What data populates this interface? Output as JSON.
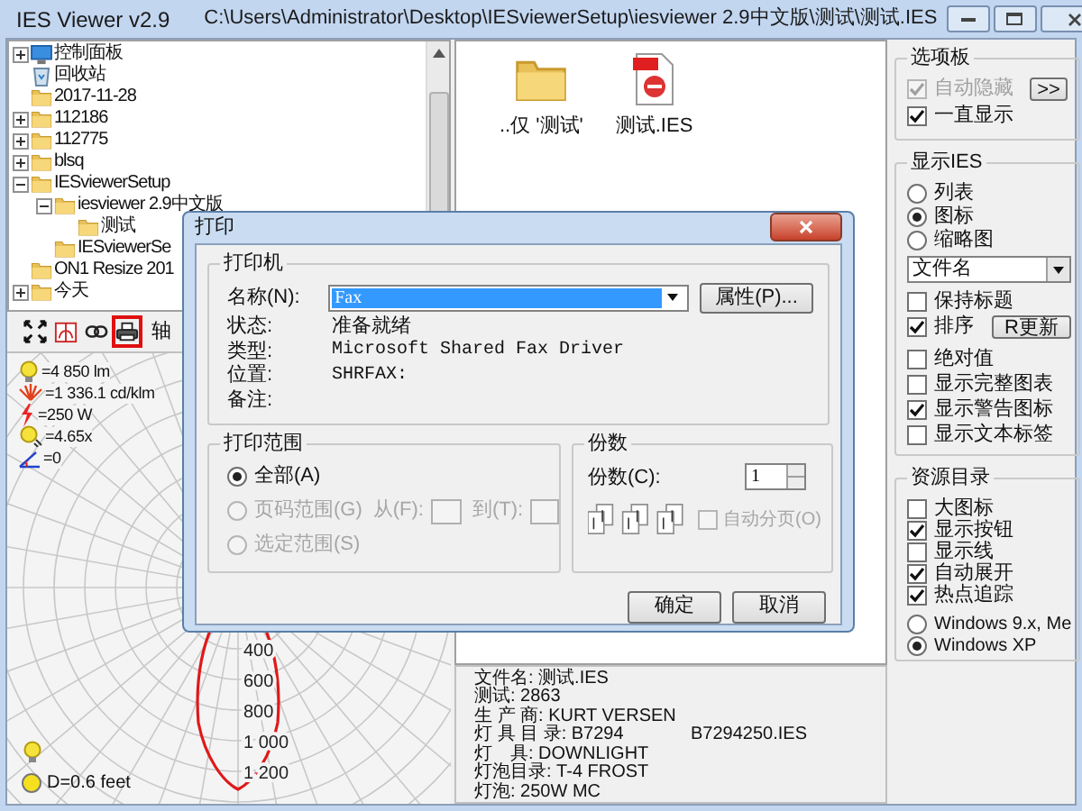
{
  "window": {
    "title": "IES Viewer v2.9",
    "path": "C:\\Users\\Administrator\\Desktop\\IESviewerSetup\\iesviewer 2.9中文版\\测试\\测试.IES"
  },
  "tree": [
    {
      "label": "控制面板",
      "kind": "control-panel",
      "expandable": true,
      "expanded": false
    },
    {
      "label": "回收站",
      "kind": "recycle-bin"
    },
    {
      "label": "2017-11-28",
      "kind": "folder"
    },
    {
      "label": "112186",
      "kind": "folder",
      "expandable": true,
      "expanded": false
    },
    {
      "label": "112775",
      "kind": "folder",
      "expandable": true,
      "expanded": false
    },
    {
      "label": "blsq",
      "kind": "folder",
      "expandable": true,
      "expanded": false
    },
    {
      "label": "IESviewerSetup",
      "kind": "folder",
      "expandable": true,
      "expanded": true,
      "children": [
        {
          "label": "iesviewer 2.9中文版",
          "kind": "folder",
          "expandable": true,
          "expanded": true,
          "children": [
            {
              "label": "测试",
              "kind": "folder"
            }
          ]
        },
        {
          "label": "IESviewerSe",
          "kind": "folder"
        }
      ]
    },
    {
      "label": "ON1 Resize 201",
      "kind": "folder"
    },
    {
      "label": "今天",
      "kind": "folder",
      "expandable": true,
      "expanded": false
    }
  ],
  "toolbar": {
    "buttons": [
      {
        "kind": "expand",
        "selected": false
      },
      {
        "kind": "chart",
        "selected": false
      },
      {
        "kind": "link",
        "selected": false
      },
      {
        "kind": "printer",
        "selected": true
      }
    ],
    "label": "轴"
  },
  "photometrics": [
    {
      "kind": "bulb",
      "text": "=4 850 lm"
    },
    {
      "kind": "intensity",
      "text": "=1 336.1 cd/klm"
    },
    {
      "kind": "power",
      "text": "=250 W"
    },
    {
      "kind": "beam",
      "text": "=4.65x"
    },
    {
      "kind": "angle",
      "text": "=0"
    }
  ],
  "polar": {
    "labels": [
      "400",
      "600",
      "800",
      "1 000",
      "1 200"
    ]
  },
  "distance": "D=0.6 feet",
  "files": [
    {
      "kind": "folder",
      "label": "..仅 '测试'"
    },
    {
      "kind": "ies",
      "label": "测试.IES"
    }
  ],
  "info": [
    {
      "text": "文件名: 测试.IES"
    },
    {
      "text": "测试: 2863"
    },
    {
      "text": "生 产 商: KURT VERSEN"
    },
    {
      "text": "灯 具 目 录: B7294",
      "extra": "B7294250.IES"
    },
    {
      "text": "灯　具: DOWNLIGHT"
    },
    {
      "text": "灯泡目录: T-4 FROST"
    },
    {
      "text": "灯泡: 250W MC"
    }
  ],
  "options": {
    "title": "选项板",
    "items": [
      {
        "label": "自动隐藏",
        "checked": true,
        "disabled": true
      },
      {
        "label": "一直显示",
        "checked": true,
        "disabled": false
      }
    ],
    "toggle": ">>"
  },
  "display": {
    "title": "显示IES",
    "views": [
      {
        "label": "列表",
        "selected": false
      },
      {
        "label": "图标",
        "selected": true
      },
      {
        "label": "缩略图",
        "selected": false
      }
    ],
    "sort_field": "文件名",
    "checks": [
      {
        "label": "保持标题",
        "checked": false
      },
      {
        "label": "排序",
        "checked": true,
        "button": "R更新"
      },
      {
        "label": "绝对值",
        "checked": false
      },
      {
        "label": "显示完整图表",
        "checked": false
      },
      {
        "label": "显示警告图标",
        "checked": true
      },
      {
        "label": "显示文本标签",
        "checked": false
      }
    ]
  },
  "resources": {
    "title": "资源目录",
    "checks": [
      {
        "label": "大图标",
        "checked": false
      },
      {
        "label": "显示按钮",
        "checked": true
      },
      {
        "label": "显示线",
        "checked": false
      },
      {
        "label": "自动展开",
        "checked": true
      },
      {
        "label": "热点追踪",
        "checked": true
      }
    ],
    "styles": [
      {
        "label": "Windows 9.x, Me",
        "selected": false
      },
      {
        "label": "Windows XP",
        "selected": true
      }
    ]
  },
  "dialog": {
    "title": "打印",
    "printer": {
      "title": "打印机",
      "name_label": "名称(N):",
      "name_value": "Fax",
      "properties": "属性(P)...",
      "fields": [
        {
          "label": "状态:",
          "value": "准备就绪",
          "kind": "text"
        },
        {
          "label": "类型:",
          "value": "Microsoft Shared Fax Driver",
          "kind": "mono"
        },
        {
          "label": "位置:",
          "value": "SHRFAX:",
          "kind": "mono"
        },
        {
          "label": "备注:"
        }
      ]
    },
    "range": {
      "title": "打印范围",
      "options": [
        {
          "label": "全部(A)",
          "selected": true,
          "disabled": false
        },
        {
          "label": "页码范围(G)",
          "selected": false,
          "disabled": true,
          "from": "从(F):",
          "to": "到(T):"
        },
        {
          "label": "选定范围(S)",
          "selected": false,
          "disabled": true
        }
      ]
    },
    "copies": {
      "title": "份数",
      "label": "份数(C):",
      "value": "1",
      "collate": {
        "label": "自动分页(O)",
        "checked": false,
        "disabled": true
      }
    },
    "buttons": [
      "确定",
      "取消"
    ]
  }
}
